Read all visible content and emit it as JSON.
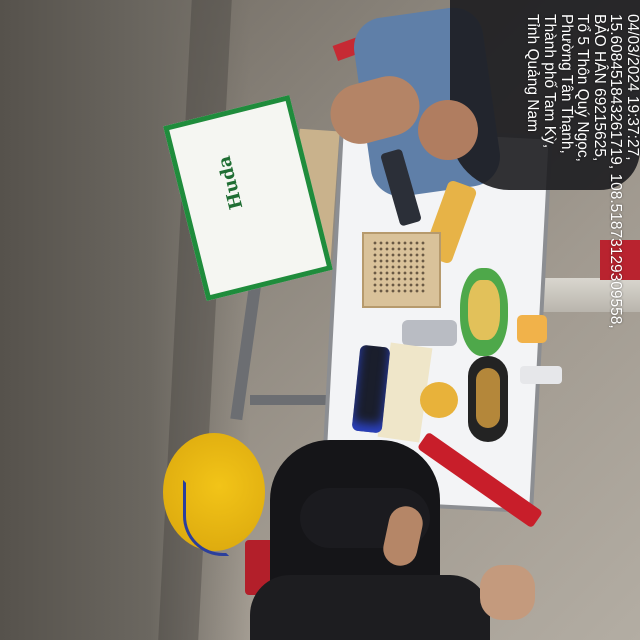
{
  "photo_stamp": {
    "lines": [
      "04/03/2024 19:37:27,",
      "15.608451843261719, 108.51873129309558,",
      "BẢO HÂN   69215625,",
      "Tổ 5 Thôn Quý Ngọc,",
      "Phường Tân Thạnh,",
      "Thành phố Tam Kỳ,",
      "Tỉnh Quảng Nam"
    ]
  },
  "scene": {
    "beer_box_brand": "Huda",
    "colors": {
      "bucket": "#f0c215",
      "chairs": "#c8202c",
      "table": "#f3f4f6",
      "box_green": "#1f8c3c",
      "stamp_text": "#ffffff"
    }
  }
}
